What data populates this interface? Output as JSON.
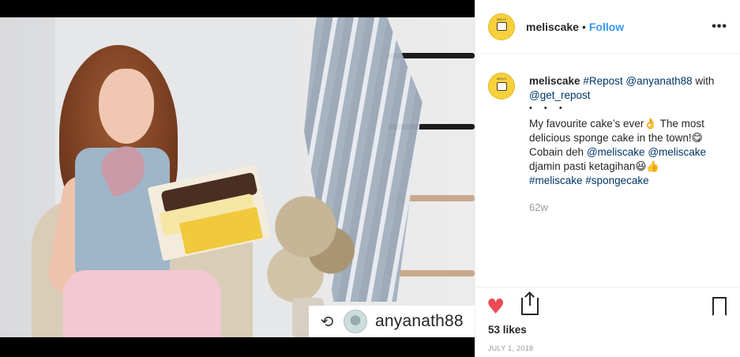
{
  "post": {
    "repost_username": "anyanath88"
  },
  "header": {
    "username": "meliscake",
    "separator": "•",
    "follow_label": "Follow",
    "more_label": "•••"
  },
  "caption": {
    "username": "meliscake",
    "line1_tag": "#Repost",
    "line1_mention": "@anyanath88",
    "line1_text": " with",
    "line2_mention": "@get_repost",
    "dots": "• • •",
    "line3": "My favourite cake’s ever👌 The most",
    "line4": "delicious sponge cake in the town!😋",
    "line5_text": "Cobain deh ",
    "line5_mention1": "@meliscake",
    "line5_mention2": "@meliscake",
    "line6": "djamin pasti ketagihan😆👍",
    "hashtag1": "#meliscake",
    "hashtag2": "#spongecake",
    "timestamp": "62w"
  },
  "actions": {
    "like_icon": "heart-icon",
    "share_icon": "share-icon",
    "save_icon": "bookmark-icon"
  },
  "stats": {
    "likes": "53 likes",
    "date": "JULY 1, 2018"
  },
  "colors": {
    "follow": "#3897f0",
    "link": "#003569",
    "heart": "#ed4956",
    "avatar_bg": "#f7d13b"
  }
}
